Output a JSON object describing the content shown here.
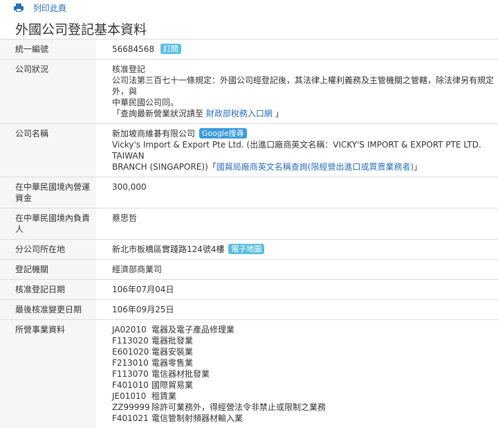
{
  "toolbar": {
    "print_label": "列印此頁"
  },
  "page_title": "外國公司登記基本資料",
  "colors": {
    "link": "#2a6ebb",
    "badge": "#5bc0de",
    "label_bg": "#f6f6f6"
  },
  "rows": {
    "unified_no": {
      "label": "統一編號",
      "value": "56684568",
      "subscribe": "訂閱"
    },
    "status": {
      "label": "公司狀況",
      "value": "核准登記",
      "note1": "公司法第三百七十一條規定：外國公司經登記後，其法律上權利義務及主管機關之管轄，除法律另有規定外，與",
      "note2": "中華民國公司同。",
      "query_prefix": "「查詢最新營業狀況請至",
      "query_link": "財政部稅務入口網",
      "query_suffix": "」"
    },
    "name": {
      "label": "公司名稱",
      "value": "新加坡商維碁有限公司",
      "google": "Google搜尋",
      "english1": "Vicky's Import & Export Pte Ltd. (出進口廠商英文名稱：VICKY'S IMPORT & EXPORT PTE LTD. TAIWAN",
      "english2_prefix": "BRANCH (SINGAPORE))「",
      "english2_link": "國貿局廠商英文名稱查詢(限經營出進口或買賣業務者)",
      "english2_suffix": "」"
    },
    "capital": {
      "label": "在中華民國境內營運資金",
      "value": "300,000"
    },
    "representative": {
      "label": "在中華民國境內負責人",
      "value": "蔡思哲"
    },
    "address": {
      "label": "分公司所在地",
      "value": "新北市板橋區實踐路124號4樓",
      "map": "電子地圖"
    },
    "authority": {
      "label": "登記機關",
      "value": "經濟部商業司"
    },
    "approve_date": {
      "label": "核准登記日期",
      "value": "106年07月04日"
    },
    "change_date": {
      "label": "最後核准變更日期",
      "value": "106年09月25日"
    },
    "business": {
      "label": "所營事業資料",
      "items": [
        {
          "code": "JA02010",
          "desc": "電器及電子產品修理業"
        },
        {
          "code": "F113020",
          "desc": "電器批發業"
        },
        {
          "code": "E601020",
          "desc": "電器安裝業"
        },
        {
          "code": "F213010",
          "desc": "電器零售業"
        },
        {
          "code": "F113070",
          "desc": "電信器材批發業"
        },
        {
          "code": "F401010",
          "desc": "國際貿易業"
        },
        {
          "code": "JE01010",
          "desc": "租賃業"
        },
        {
          "code": "ZZ99999",
          "desc": "除許可業務外，得經營法令非禁止或限制之業務"
        },
        {
          "code": "F401021",
          "desc": "電信管制射頻器材輸入業"
        }
      ]
    }
  }
}
